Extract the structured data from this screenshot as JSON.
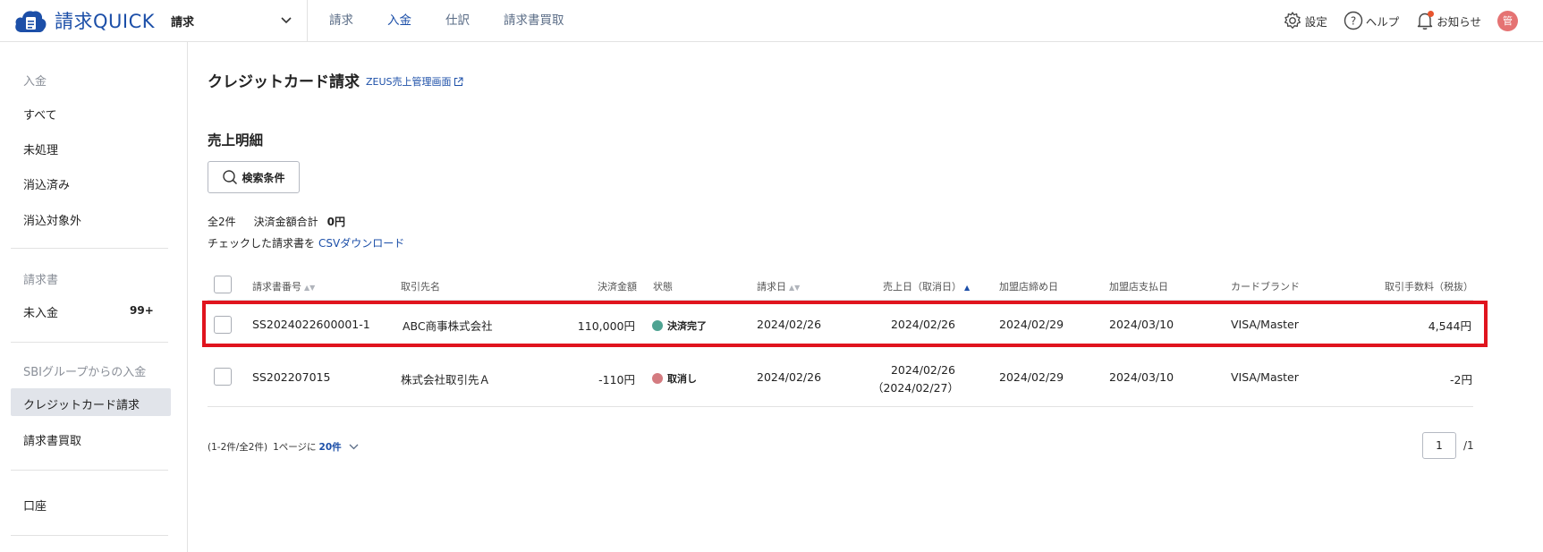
{
  "header": {
    "logo_text": "請求QUICK",
    "app_select": "請求",
    "nav": [
      {
        "label": "請求"
      },
      {
        "label": "入金"
      },
      {
        "label": "仕訳"
      },
      {
        "label": "請求書買取"
      }
    ],
    "settings_label": "設定",
    "help_label": "ヘルプ",
    "notice_label": "お知らせ",
    "avatar_initial": "管"
  },
  "sidebar": {
    "section_payment": "入金",
    "items_payment": [
      "すべて",
      "未処理",
      "消込済み",
      "消込対象外"
    ],
    "section_invoice": "請求書",
    "unpaid_label": "未入金",
    "unpaid_badge": "99+",
    "section_sbi": "SBIグループからの入金",
    "credit_label": "クレジットカード請求",
    "factoring_label": "請求書買取",
    "account_label": "口座"
  },
  "main": {
    "page_title": "クレジットカード請求",
    "zeus_link": "ZEUS売上管理画面",
    "section_title": "売上明細",
    "search_button": "検索条件",
    "total_count": "全2件",
    "settlement_total_label": "決済金額合計",
    "settlement_total_value": "0円",
    "csv_prefix": "チェックした請求書を",
    "csv_link": "CSVダウンロード"
  },
  "table": {
    "headers": {
      "invoice_no": "請求書番号",
      "client": "取引先名",
      "amount": "決済金額",
      "status": "状態",
      "invoice_date": "請求日",
      "sales_date": "売上日（取消日）",
      "closing_date": "加盟店締め日",
      "payment_date": "加盟店支払日",
      "brand": "カードブランド",
      "fee": "取引手数料（税抜）"
    },
    "rows": [
      {
        "invoice_no": "SS2024022600001-1",
        "client": "ABC商事株式会社",
        "amount": "110,000円",
        "status": "決済完了",
        "invoice_date": "2024/02/26",
        "sales_date": "2024/02/26",
        "closing_date": "2024/02/29",
        "payment_date": "2024/03/10",
        "brand": "VISA/Master",
        "fee": "4,544円"
      },
      {
        "invoice_no": "SS202207015",
        "client": "株式会社取引先Ａ",
        "amount": "-110円",
        "status": "取消し",
        "invoice_date": "2024/02/26",
        "sales_date": "2024/02/26",
        "cancel_date": "（2024/02/27）",
        "closing_date": "2024/02/29",
        "payment_date": "2024/03/10",
        "brand": "VISA/Master",
        "fee": "-2円"
      }
    ]
  },
  "pager": {
    "range": "(1-2件/全2件)",
    "per_page_label": "1ページに",
    "per_page_value": "20件",
    "current_page": "1",
    "total_pages": "/1"
  },
  "colors": {
    "brand": "#1c4fa8",
    "status_complete": "#4ea392",
    "status_cancel": "#d47b80",
    "highlight": "#e0141e"
  }
}
